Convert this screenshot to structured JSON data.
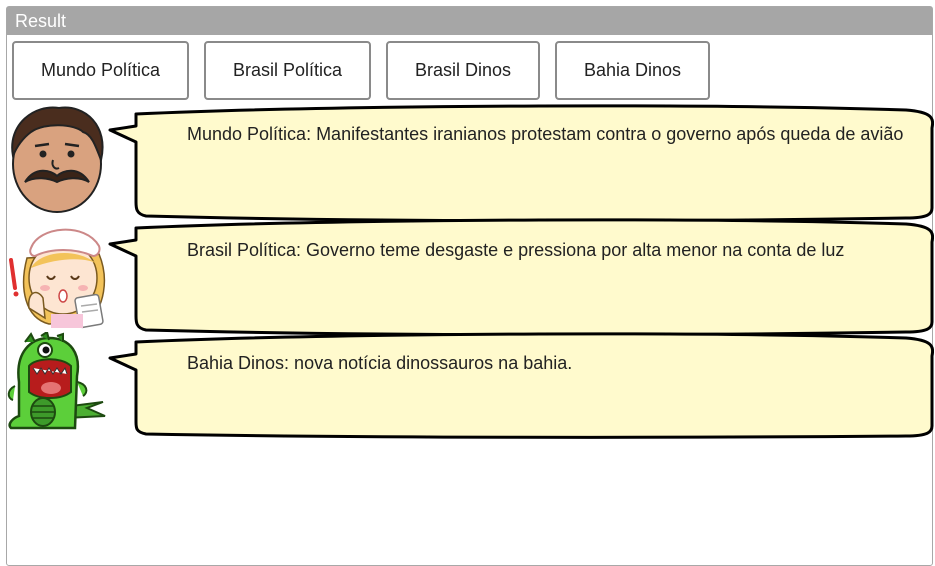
{
  "window": {
    "title": "Result"
  },
  "buttons": [
    {
      "label": "Mundo Política"
    },
    {
      "label": "Brasil Política"
    },
    {
      "label": "Brasil Dinos"
    },
    {
      "label": "Bahia Dinos"
    }
  ],
  "messages": [
    {
      "speaker": "man-with-mustache",
      "text": "Mundo Política: Manifestantes iranianos protestam contra o governo após queda de avião"
    },
    {
      "speaker": "nurse",
      "text": "Brasil Política: Governo teme desgaste e pressiona por alta menor na conta de luz"
    },
    {
      "speaker": "green-dinosaur",
      "text": "Bahia Dinos: nova notícia dinossauros na bahia."
    }
  ],
  "colors": {
    "titlebar": "#a6a6a6",
    "bubble_fill": "#fffacd",
    "bubble_stroke": "#000000"
  }
}
